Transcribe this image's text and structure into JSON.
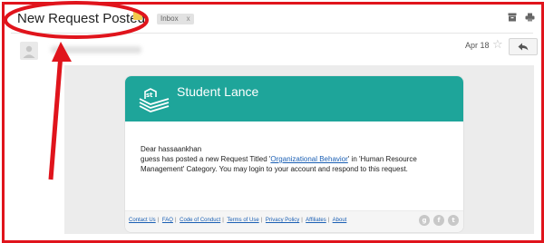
{
  "email": {
    "subject": "New Request Posted",
    "label_chip": "Inbox",
    "label_chip_close": "x",
    "date": "Apr 18",
    "star_glyph": "☆"
  },
  "card": {
    "brand_name": "Student Lance",
    "logo_text": "st",
    "greeting": "Dear hassaankhan",
    "body_before_link": "guess has posted a new Request Titled '",
    "link_text": "Organizational Behavior",
    "body_after_link": "' in 'Human Resource Management' Category. You may login to your account and respond to this request.",
    "header_color": "#1ea59a"
  },
  "footer": {
    "links": [
      "Contact Us",
      "FAQ",
      "Code of Conduct",
      "Terms of Use",
      "Privacy Policy",
      "Affiliates",
      "About"
    ],
    "separator": "|",
    "social_icons": [
      "google-plus-icon",
      "facebook-icon",
      "twitter-icon"
    ],
    "social_glyphs": [
      "g",
      "f",
      "t"
    ]
  },
  "icons": {
    "top_right": [
      "archive-icon",
      "print-icon"
    ],
    "reply": "reply-icon"
  },
  "colors": {
    "annotation_red": "#e0141c",
    "link_blue": "#1a5fb4",
    "label_yellow": "#f2c94c"
  }
}
